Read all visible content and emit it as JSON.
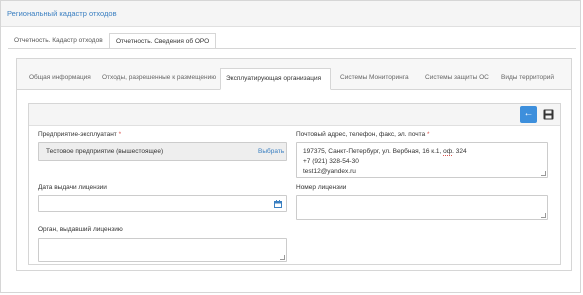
{
  "header": {
    "title": "Региональный кадастр отходов"
  },
  "top_tabs": [
    {
      "label": "Отчетность. Кадастр отходов",
      "active": false
    },
    {
      "label": "Отчетность. Сведения об ОРО",
      "active": true
    }
  ],
  "inner_tabs": [
    {
      "label": "Общая информация",
      "active": false
    },
    {
      "label": "Отходы, разрешенные к размещению",
      "active": false
    },
    {
      "label": "Эксплуатирующая организация",
      "active": true
    },
    {
      "label": "Системы Мониторинга",
      "active": false
    },
    {
      "label": "Системы защиты ОС",
      "active": false
    },
    {
      "label": "Виды территорий",
      "active": false
    }
  ],
  "toolbar": {
    "back_icon": "←",
    "save_icon": "save-icon"
  },
  "form": {
    "enterprise": {
      "label": "Предприятие-эксплуатант",
      "required_mark": "*",
      "value": "Тестовое предприятие (вышестоящее)",
      "pick_label": "Выбрать"
    },
    "address": {
      "label": "Почтовый адрес, телефон, факс, эл. почта",
      "required_mark": "*",
      "line1_pre": "197375, Санкт-Петербург, ул. Вербная, 16 к.1, ",
      "line1_mark": "оф",
      "line1_post": ". 324",
      "line2": "+7 (921) 328-54-30",
      "line3": "test12@yandex.ru"
    },
    "license_date": {
      "label": "Дата выдачи лицензии",
      "value": ""
    },
    "license_number": {
      "label": "Номер лицензии",
      "value": ""
    },
    "license_issuer": {
      "label": "Орган, выдавший лицензию",
      "value": ""
    }
  },
  "colors": {
    "accent": "#3d8fdc",
    "link": "#3a7fc1",
    "required": "#d9534f"
  }
}
